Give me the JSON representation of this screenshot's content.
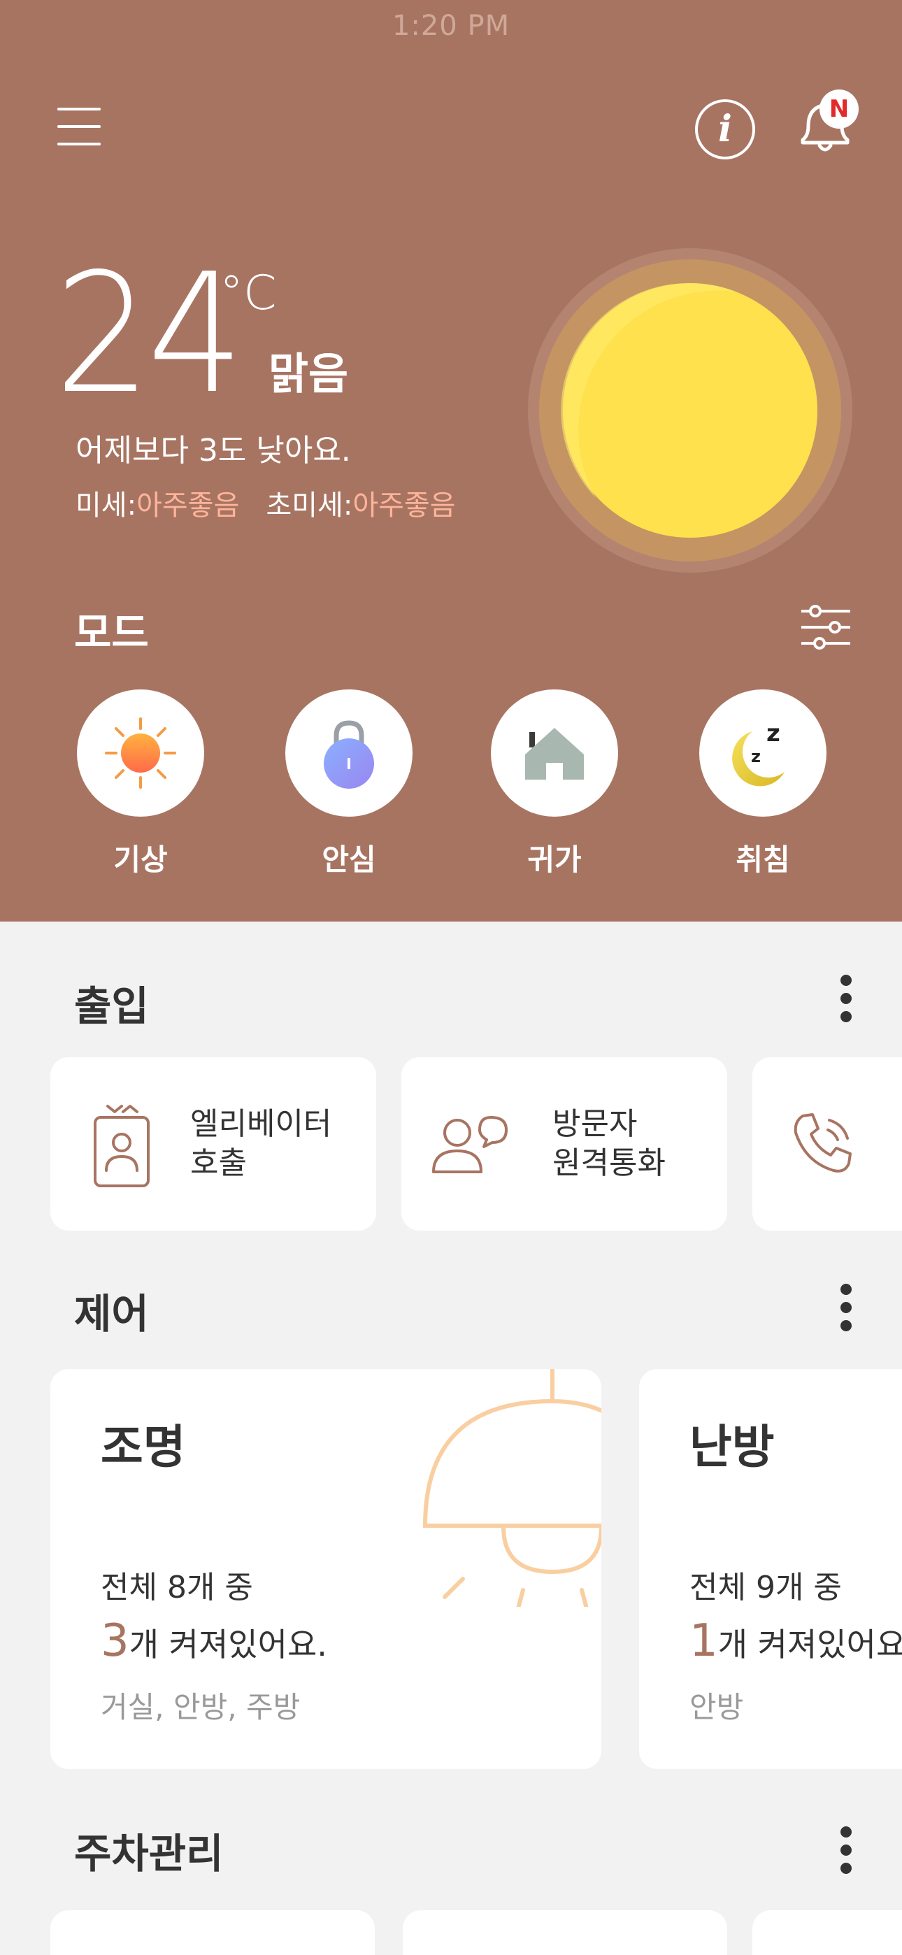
{
  "status_bar": {
    "time": "1:20 PM"
  },
  "header": {
    "info_label": "i",
    "notification_badge": "N"
  },
  "weather": {
    "temperature": "24",
    "unit": "°C",
    "condition": "맑음",
    "comparison": "어제보다 3도 낮아요.",
    "fine_dust_label": "미세:",
    "fine_dust_value": "아주좋음",
    "ultrafine_dust_label": "초미세:",
    "ultrafine_dust_value": "아주좋음",
    "icon": "sun-icon"
  },
  "modes": {
    "title": "모드",
    "items": [
      {
        "label": "기상",
        "icon": "sunrise-icon"
      },
      {
        "label": "안심",
        "icon": "lock-icon"
      },
      {
        "label": "귀가",
        "icon": "house-icon"
      },
      {
        "label": "취침",
        "icon": "moon-sleep-icon"
      }
    ]
  },
  "access": {
    "title": "출입",
    "items": [
      {
        "line1": "엘리베이터",
        "line2": "호출",
        "icon": "elevator-icon"
      },
      {
        "line1": "방문자",
        "line2": "원격통화",
        "icon": "visitor-call-icon"
      },
      {
        "line1": "",
        "line2": "",
        "icon": "phone-call-icon"
      }
    ]
  },
  "control": {
    "title": "제어",
    "cards": [
      {
        "title": "조명",
        "total": "전체 8개 중",
        "on_count": "3",
        "on_text": "개 켜져있어요.",
        "rooms": "거실, 안방, 주방",
        "icon": "lamp-icon"
      },
      {
        "title": "난방",
        "total": "전체 9개 중",
        "on_count": "1",
        "on_text": "개 켜져있어요.",
        "rooms": "안방",
        "icon": "heater-icon"
      }
    ]
  },
  "parking": {
    "title": "주차관리"
  },
  "colors": {
    "hero": "#a87462",
    "accent": "#a87462",
    "dust_good": "#ffb49a",
    "sun": "#ffe14d"
  }
}
